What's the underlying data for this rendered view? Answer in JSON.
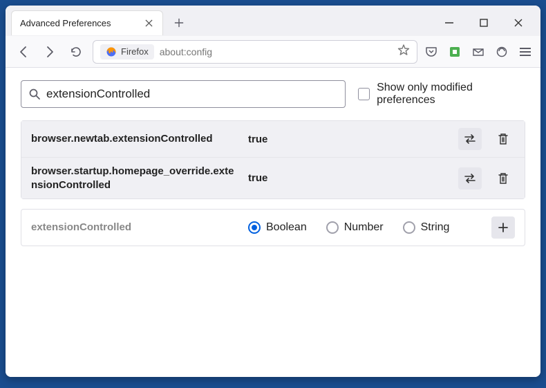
{
  "window": {
    "tab_title": "Advanced Preferences"
  },
  "toolbar": {
    "firefox_label": "Firefox",
    "url": "about:config"
  },
  "search": {
    "value": "extensionControlled",
    "checkbox_label": "Show only modified preferences"
  },
  "prefs": [
    {
      "name": "browser.newtab.extensionControlled",
      "value": "true"
    },
    {
      "name": "browser.startup.homepage_override.extensionControlled",
      "value": "true"
    }
  ],
  "add": {
    "name": "extensionControlled",
    "types": {
      "boolean": "Boolean",
      "number": "Number",
      "string": "String"
    }
  }
}
